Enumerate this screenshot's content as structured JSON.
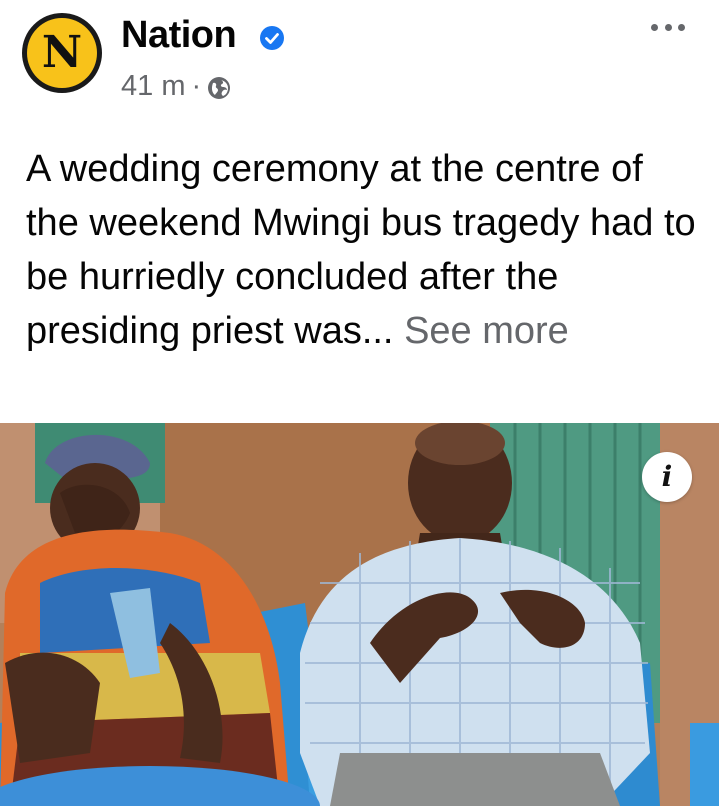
{
  "post": {
    "author": {
      "name": "Nation",
      "avatar_letter": "N",
      "verified": true
    },
    "timestamp": "41 m",
    "separator": "·",
    "audience_icon": "globe-icon",
    "caption": "A wedding ceremony at the centre of the weekend Mwingi bus tragedy had to be hurriedly concluded after the presiding priest was...",
    "see_more_label": "See more",
    "info_glyph": "i"
  },
  "colors": {
    "avatar_bg": "#f8c21a",
    "verified_blue": "#1877f2",
    "secondary_text": "#65676b"
  },
  "icons": [
    "verified-badge-icon",
    "globe-icon",
    "more-options-icon",
    "info-icon"
  ]
}
